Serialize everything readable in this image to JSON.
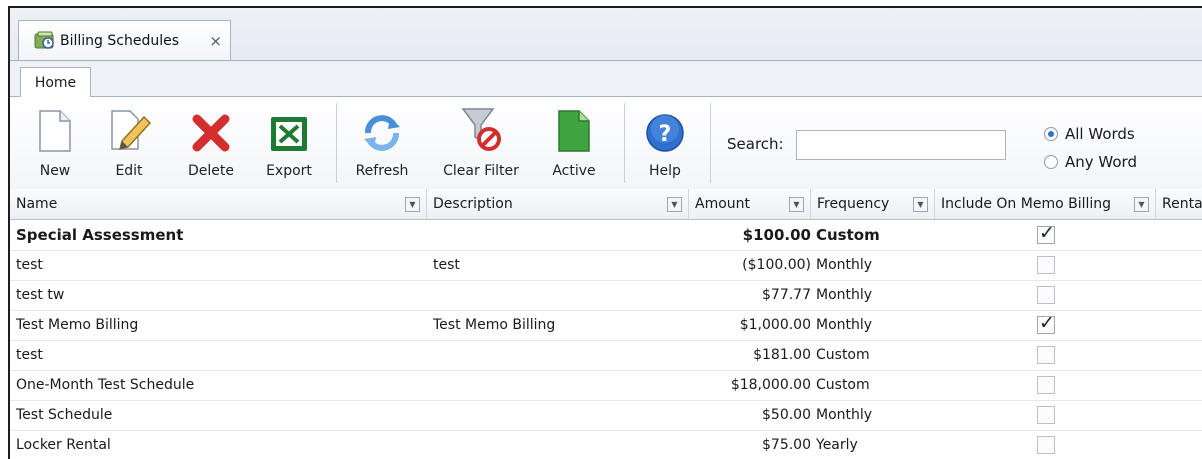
{
  "doc_tab": {
    "label": "Billing Schedules",
    "close": "×"
  },
  "ribbon_tab": "Home",
  "toolbar": {
    "new": "New",
    "edit": "Edit",
    "delete": "Delete",
    "export": "Export",
    "refresh": "Refresh",
    "clear_filter": "Clear Filter",
    "active": "Active",
    "help": "Help"
  },
  "search": {
    "label": "Search:",
    "value": ""
  },
  "match_options": [
    {
      "label": "All Words",
      "selected": true
    },
    {
      "label": "Any Word",
      "selected": false
    }
  ],
  "columns": [
    "Name",
    "Description",
    "Amount",
    "Frequency",
    "Include On Memo Billing",
    "Renta"
  ],
  "rows": [
    {
      "name": "Special Assessment",
      "description": "",
      "amount": "$100.00",
      "frequency": "Custom",
      "memo": true,
      "bold": true
    },
    {
      "name": "test",
      "description": "test",
      "amount": "($100.00)",
      "frequency": "Monthly",
      "memo": false
    },
    {
      "name": "test tw",
      "description": "",
      "amount": "$77.77",
      "frequency": "Monthly",
      "memo": false
    },
    {
      "name": "Test Memo Billing",
      "description": "Test Memo Billing",
      "amount": "$1,000.00",
      "frequency": "Monthly",
      "memo": true
    },
    {
      "name": "test",
      "description": "",
      "amount": "$181.00",
      "frequency": "Custom",
      "memo": false
    },
    {
      "name": "One-Month Test Schedule",
      "description": "",
      "amount": "$18,000.00",
      "frequency": "Custom",
      "memo": false
    },
    {
      "name": "Test Schedule",
      "description": "",
      "amount": "$50.00",
      "frequency": "Monthly",
      "memo": false
    },
    {
      "name": "Locker Rental",
      "description": "",
      "amount": "$75.00",
      "frequency": "Yearly",
      "memo": false
    }
  ],
  "icons": {
    "doc_tab": "billing-schedule-icon",
    "new": "new-document-icon",
    "edit": "edit-pencil-icon",
    "delete": "delete-x-icon",
    "export": "excel-export-icon",
    "refresh": "refresh-arrows-icon",
    "clear_filter": "clear-filter-funnel-icon",
    "active": "active-document-icon",
    "help": "help-question-icon"
  },
  "colors": {
    "delete": "#d32f2f",
    "excel": "#1f7a34",
    "active": "#3fa33f",
    "help": "#2f6fcf",
    "refresh": "#4a90d9"
  }
}
